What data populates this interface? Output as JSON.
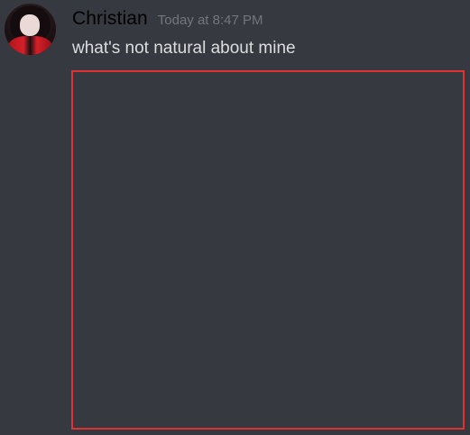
{
  "message": {
    "author": "Christian",
    "timestamp": "Today at 8:47 PM",
    "content": "what's not natural about mine"
  },
  "colors": {
    "background": "#36393f",
    "username": "#000000",
    "timestamp": "#72767d",
    "content": "#dcddde",
    "attachment_border": "#e03232"
  }
}
